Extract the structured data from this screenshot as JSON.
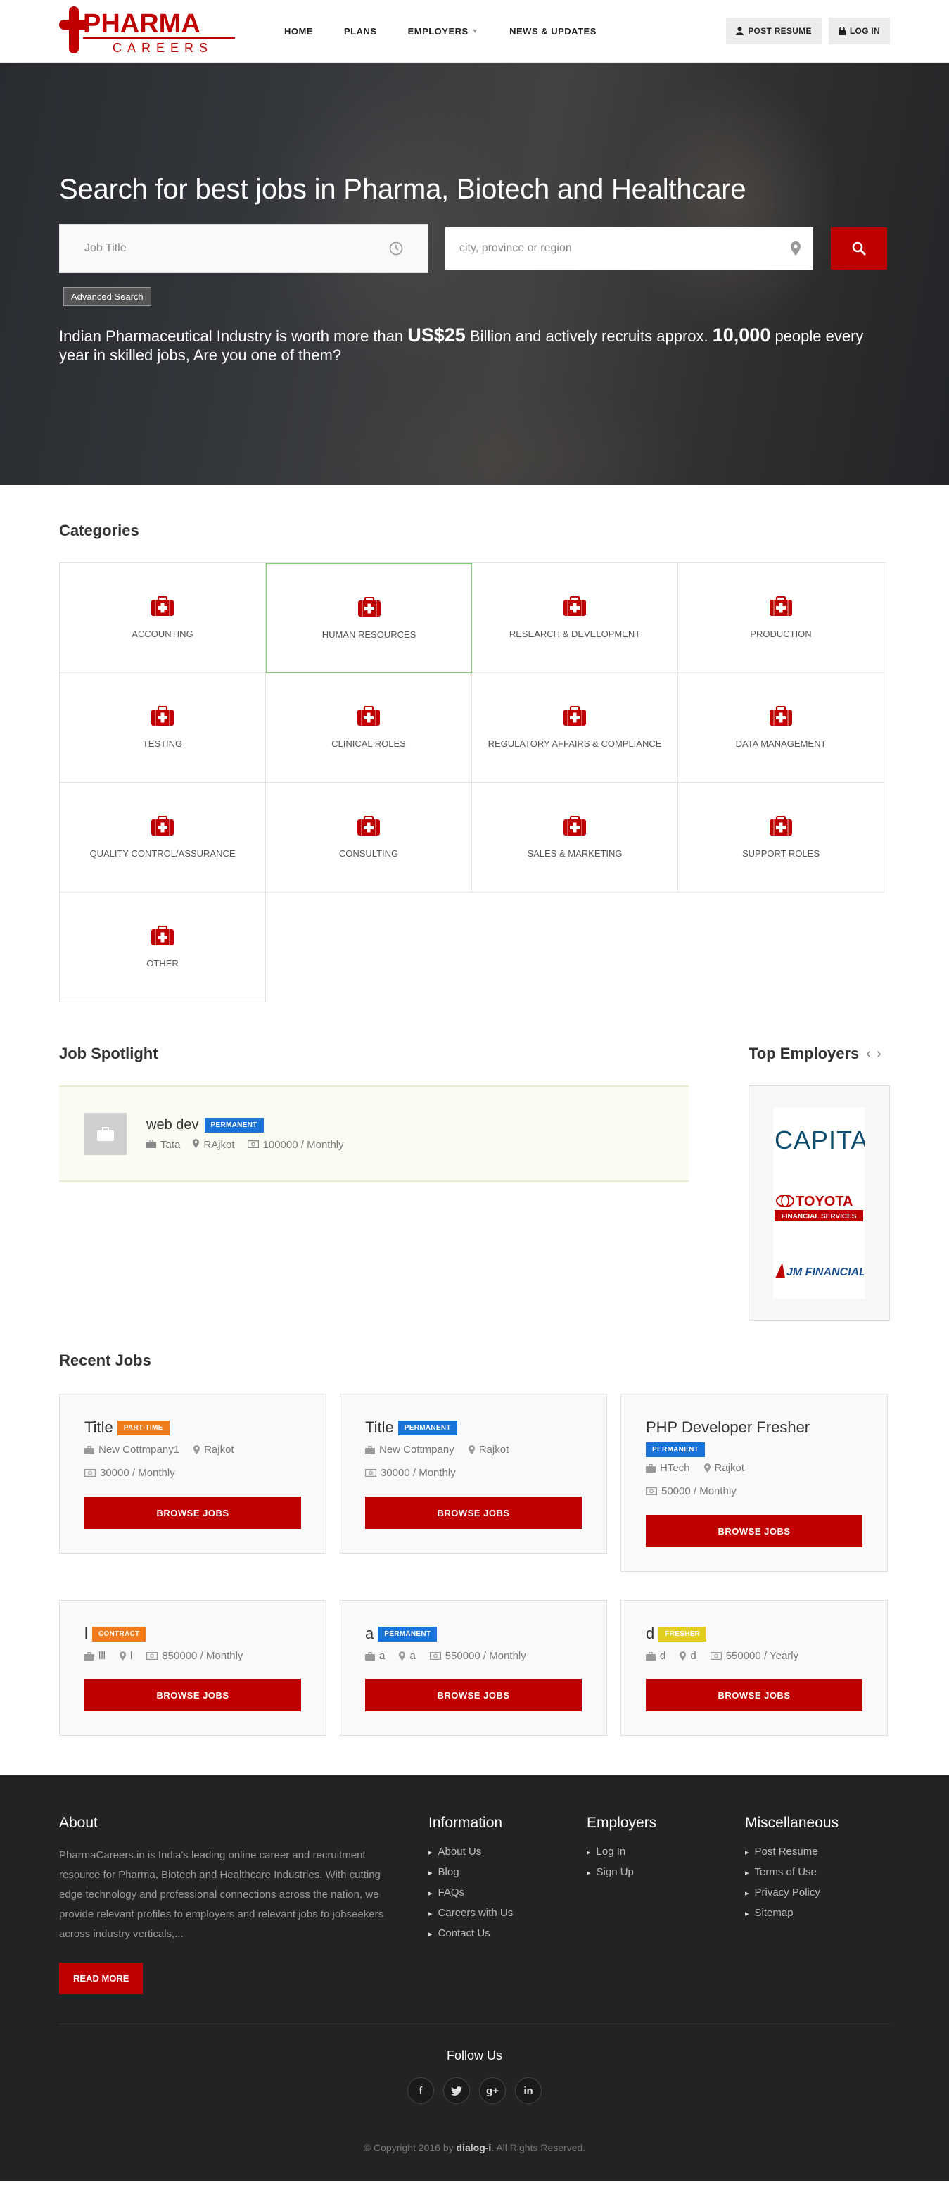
{
  "brand": {
    "name_top": "PHARMA",
    "name_bottom": "CAREERS",
    "accent": "#c00000"
  },
  "nav": [
    {
      "label": "HOME"
    },
    {
      "label": "PLANS"
    },
    {
      "label": "EMPLOYERS"
    },
    {
      "label": "NEWS & UPDATES"
    }
  ],
  "header_actions": {
    "post_resume": "POST RESUME",
    "login": "LOG IN"
  },
  "hero": {
    "title": "Search for best jobs in Pharma, Biotech and Healthcare",
    "job_placeholder": "Job Title",
    "location_placeholder": "city, province or region",
    "advanced_search": "Advanced Search",
    "stat_pre": "Indian Pharmaceutical Industry is worth more than ",
    "stat_value1": "US$25",
    "stat_mid": " Billion and actively recruits approx. ",
    "stat_value2": "10,000",
    "stat_post": " people every year in skilled jobs, Are you one of them?"
  },
  "categories": {
    "title": "Categories",
    "items": [
      "ACCOUNTING",
      "HUMAN RESOURCES",
      "RESEARCH & DEVELOPMENT",
      "PRODUCTION",
      "TESTING",
      "CLINICAL ROLES",
      "REGULATORY AFFAIRS & COMPLIANCE",
      "DATA MANAGEMENT",
      "QUALITY CONTROL/ASSURANCE",
      "CONSULTING",
      "SALES & MARKETING",
      "SUPPORT ROLES",
      "OTHER"
    ]
  },
  "spotlight": {
    "title": "Job Spotlight",
    "job_title": "web dev",
    "badge": "PERMANENT",
    "company": "Tata",
    "location": "RAjkot",
    "salary": "100000 / Monthly"
  },
  "top_employers": {
    "title": "Top Employers",
    "logos": [
      "CAPITA",
      "TOYOTA",
      "FINANCIAL SERVICES",
      "JM FINANCIAL"
    ]
  },
  "recent_jobs": {
    "title": "Recent Jobs",
    "browse_label": "BROWSE JOBS",
    "jobs": [
      {
        "title": "Title",
        "badge": "PART-TIME",
        "company": "New Cottmpany1",
        "location": "Rajkot",
        "salary": "30000 / Monthly"
      },
      {
        "title": "Title",
        "badge": "PERMANENT",
        "company": "New Cottmpany",
        "location": "Rajkot",
        "salary": "30000 / Monthly"
      },
      {
        "title": "PHP Developer Fresher",
        "badge": "PERMANENT",
        "company": "HTech",
        "location": "Rajkot",
        "salary": "50000 / Monthly"
      },
      {
        "title": "l",
        "badge": "CONTRACT",
        "company": "lll",
        "location": "l",
        "salary": "850000 / Monthly"
      },
      {
        "title": "a",
        "badge": "PERMANENT",
        "company": "a",
        "location": "a",
        "salary": "550000 / Monthly"
      },
      {
        "title": "d",
        "badge": "FRESHER",
        "company": "d",
        "location": "d",
        "salary": "550000 / Yearly"
      }
    ]
  },
  "footer": {
    "about_title": "About",
    "about_text": "PharmaCareers.in is India's leading online career and recruitment resource for Pharma, Biotech and Healthcare Industries. With cutting edge technology and professional connections across the nation, we provide relevant profiles to employers and relevant jobs to jobseekers across industry verticals,...",
    "read_more": "READ MORE",
    "info_title": "Information",
    "info_links": [
      "About Us",
      "Blog",
      "FAQs",
      "Careers with Us",
      "Contact Us"
    ],
    "emp_title": "Employers",
    "emp_links": [
      "Log In",
      "Sign Up"
    ],
    "misc_title": "Miscellaneous",
    "misc_links": [
      "Post Resume",
      "Terms of Use",
      "Privacy Policy",
      "Sitemap"
    ],
    "follow": "Follow Us",
    "socials": [
      "f",
      "t",
      "g+",
      "in"
    ],
    "copyright_pre": "© Copyright 2016 by ",
    "copyright_brand": "dialog-i",
    "copyright_post": ". All Rights Reserved."
  }
}
